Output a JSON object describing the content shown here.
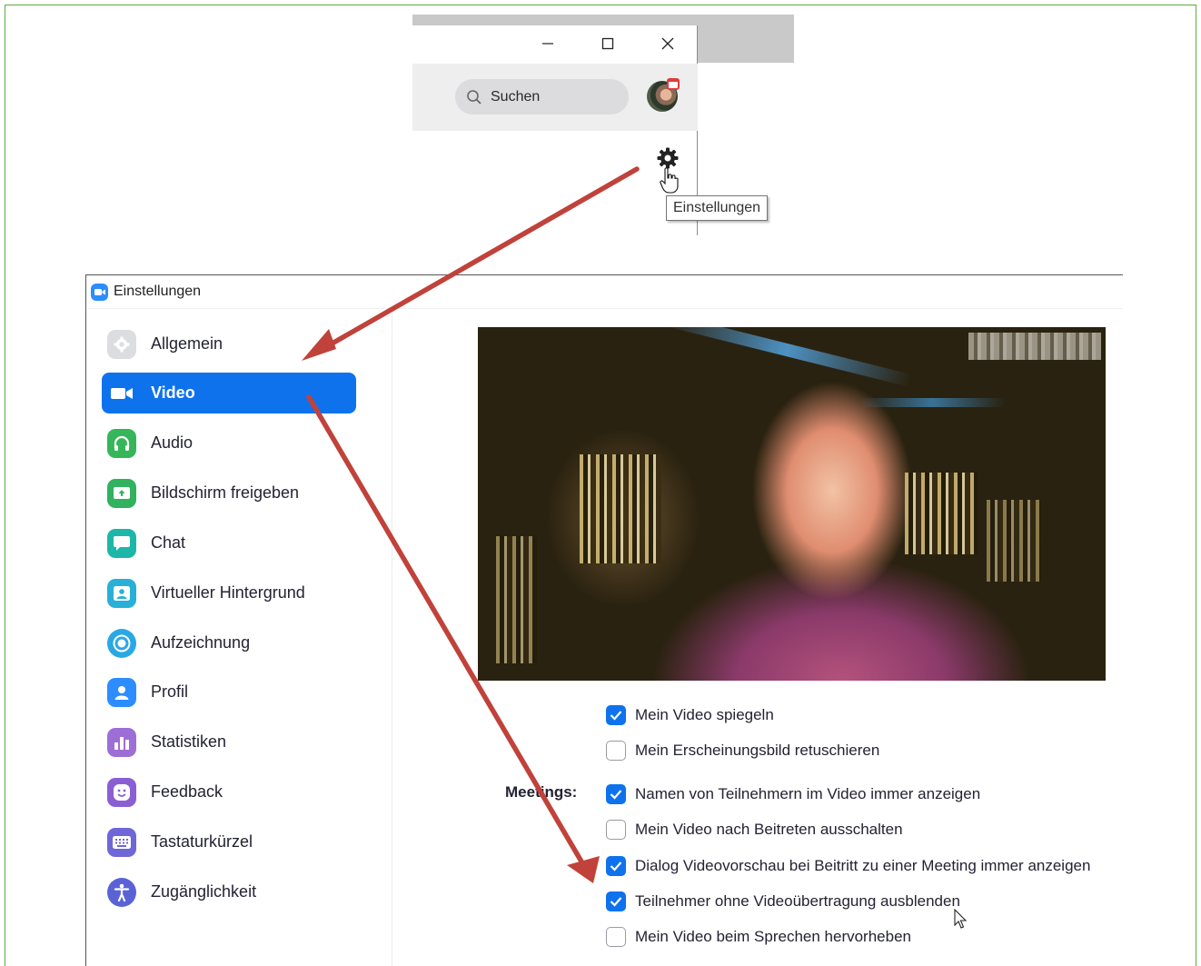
{
  "main_window": {
    "search_placeholder": "Suchen",
    "settings_tooltip": "Einstellungen"
  },
  "dialog": {
    "title": "Einstellungen",
    "nav": [
      {
        "label": "Allgemein",
        "icon": "gear-icon",
        "color": "#dcdde1"
      },
      {
        "label": "Video",
        "icon": "video-camera-icon",
        "color": "#0e72ed",
        "active": true
      },
      {
        "label": "Audio",
        "icon": "headphones-icon",
        "color": "#35b65a"
      },
      {
        "label": "Bildschirm freigeben",
        "icon": "share-screen-icon",
        "color": "#31b25e"
      },
      {
        "label": "Chat",
        "icon": "chat-bubble-icon",
        "color": "#1cb7a8"
      },
      {
        "label": "Virtueller Hintergrund",
        "icon": "virtual-background-icon",
        "color": "#28b0d8"
      },
      {
        "label": "Aufzeichnung",
        "icon": "record-icon",
        "color": "#29a8e6"
      },
      {
        "label": "Profil",
        "icon": "profile-icon",
        "color": "#2d8cff"
      },
      {
        "label": "Statistiken",
        "icon": "statistics-icon",
        "color": "#9d6ed6"
      },
      {
        "label": "Feedback",
        "icon": "feedback-smiley-icon",
        "color": "#8b5fd3"
      },
      {
        "label": "Tastaturkürzel",
        "icon": "keyboard-icon",
        "color": "#6f66d8"
      },
      {
        "label": "Zugänglichkeit",
        "icon": "accessibility-icon",
        "color": "#5a63d6"
      }
    ],
    "video": {
      "options": [
        {
          "label": "Mein Video spiegeln",
          "checked": true
        },
        {
          "label": "Mein Erscheinungsbild retuschieren",
          "checked": false
        }
      ],
      "meetings_label": "Meetings:",
      "meeting_options": [
        {
          "label": "Namen von Teilnehmern im Video immer anzeigen",
          "checked": true
        },
        {
          "label": "Mein Video nach Beitreten ausschalten",
          "checked": false
        },
        {
          "label": "Dialog Videovorschau bei Beitritt zu einer Meeting immer anzeigen",
          "checked": true
        },
        {
          "label": "Teilnehmer ohne Videoübertragung ausblenden",
          "checked": true
        },
        {
          "label": "Mein Video beim Sprechen hervorheben",
          "checked": false
        }
      ]
    }
  },
  "colors": {
    "accent": "#0e72ed",
    "annotation_arrow": "#c0423a",
    "frame_border": "#5aad3a"
  }
}
